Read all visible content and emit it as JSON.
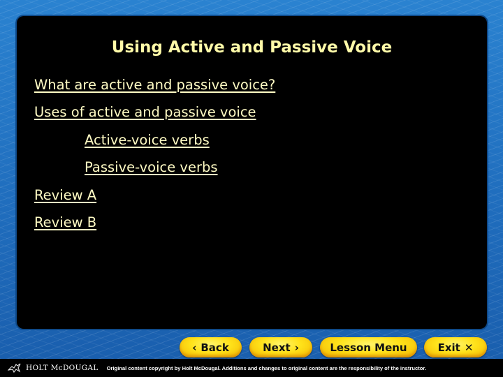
{
  "slide": {
    "title": "Using Active and Passive Voice",
    "menu_items": [
      {
        "label": "What are active and passive voice?",
        "level": 0
      },
      {
        "label": "Uses of active and passive voice",
        "level": 0
      },
      {
        "label": "Active-voice verbs",
        "level": 1
      },
      {
        "label": "Passive-voice verbs",
        "level": 1
      },
      {
        "label": "Review A",
        "level": 0
      },
      {
        "label": "Review B",
        "level": 0
      }
    ]
  },
  "nav": {
    "back_label": "Back",
    "back_icon": "‹",
    "next_label": "Next",
    "next_icon": "›",
    "lesson_menu_label": "Lesson Menu",
    "exit_label": "Exit",
    "exit_icon": "✕"
  },
  "footer": {
    "brand": "HOLT McDOUGAL",
    "copyright": "Original content copyright by Holt McDougal.  Additions and changes to original content are the responsibility of the instructor."
  },
  "colors": {
    "title": "#fffaa8",
    "links": "#fffbc4",
    "panel": "#000000",
    "background": "#1f6fbf",
    "button": "#ffe21a"
  }
}
